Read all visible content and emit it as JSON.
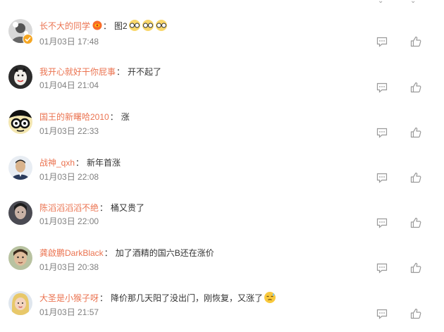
{
  "comments": [
    {
      "username": "长不大的同学",
      "text": "图2",
      "time": "01月03日 17:48",
      "verified": true,
      "vip": true,
      "emojis": [
        "doge-glasses",
        "doge-glasses",
        "doge-glasses"
      ],
      "avatar_icon": "default-avatar"
    },
    {
      "username": "我开心就好干你屁事",
      "text": "开不起了",
      "time": "01月04日 21:04",
      "avatar_icon": "avatar-photo"
    },
    {
      "username": "国王的新曙哈2010",
      "text": "涨",
      "time": "01月03日 22:33",
      "avatar_icon": "avatar-cartoon-glasses"
    },
    {
      "username": "战神_qxh",
      "text": "新年首涨",
      "time": "01月03日 22:08",
      "avatar_icon": "avatar-photo"
    },
    {
      "username": "陈滔滔滔滔不绝",
      "text": "桶又贵了",
      "time": "01月03日 22:00",
      "avatar_icon": "avatar-photo"
    },
    {
      "username": "龚啟鹏DarkBlack",
      "text": "加了酒精的国六B还在涨价",
      "time": "01月03日 20:38",
      "avatar_icon": "avatar-photo"
    },
    {
      "username": "大圣是小猴子呀",
      "text": "降价那几天阳了没出门，刚恢复，又涨了",
      "time": "01月03日 21:57",
      "emojis": [
        "awkward-face"
      ],
      "avatar_icon": "avatar-photo"
    }
  ],
  "colors": {
    "username": "#eb7350",
    "text": "#333333",
    "time": "#808080",
    "icon": "#9a9a9a"
  },
  "icons": {
    "reply": "comment-icon",
    "like": "thumbs-up-icon"
  }
}
